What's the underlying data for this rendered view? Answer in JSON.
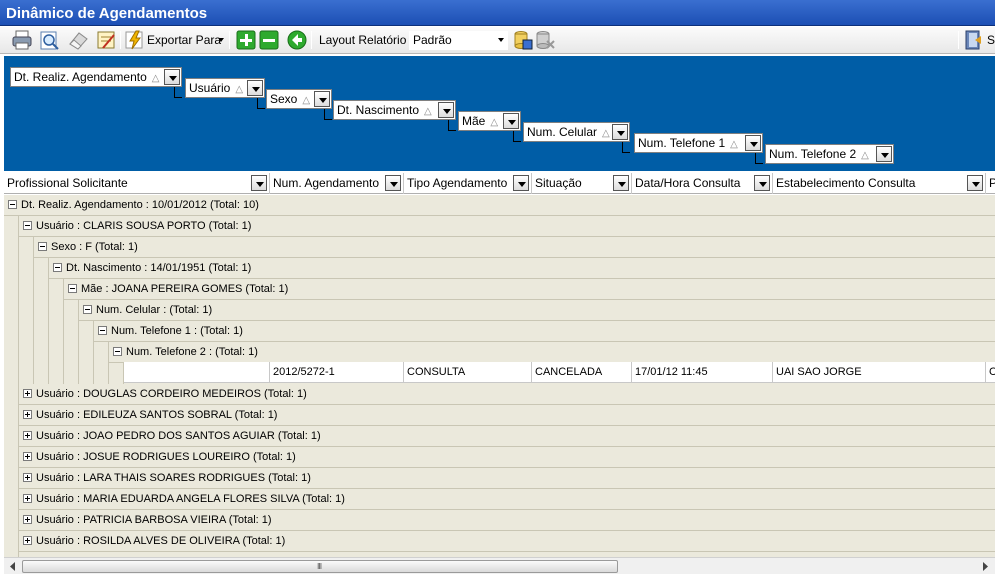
{
  "window": {
    "title": "Dinâmico de Agendamentos"
  },
  "toolbar": {
    "export_label": "Exportar Para",
    "layout_label": "Layout Relatório",
    "layout_value": "Padrão",
    "right_label": "S",
    "icons": [
      "printer-icon",
      "preview-icon",
      "eraser-icon",
      "edit-form-icon",
      "lightning-icon",
      "add-icon",
      "remove-icon",
      "back-icon",
      "save-db-icon",
      "delete-db-icon",
      "exit-icon"
    ]
  },
  "group_panel": {
    "groups": [
      "Dt. Realiz. Agendamento",
      "Usuário",
      "Sexo",
      "Dt. Nascimento",
      "Mãe",
      "Num. Celular",
      "Num. Telefone 1",
      "Num. Telefone 2"
    ],
    "sort_glyph": "△"
  },
  "columns": [
    "Profissional Solicitante",
    "Num. Agendamento",
    "Tipo Agendamento",
    "Situação",
    "Data/Hora Consulta",
    "Estabelecimento Consulta",
    "P"
  ],
  "tree": [
    {
      "label": "Dt. Realiz. Agendamento : 10/01/2012 (Total: 10)"
    },
    {
      "label": "Usuário : CLARIS SOUSA PORTO (Total: 1)"
    },
    {
      "label": "Sexo : F (Total: 1)"
    },
    {
      "label": "Dt. Nascimento : 14/01/1951 (Total: 1)"
    },
    {
      "label": "Mãe : JOANA PEREIRA GOMES (Total: 1)"
    },
    {
      "label": "Num. Celular :  (Total: 1)"
    },
    {
      "label": "Num. Telefone 1 :  (Total: 1)"
    },
    {
      "label": "Num. Telefone 2 :  (Total: 1)"
    }
  ],
  "data_row": {
    "profissional": "",
    "num_agendamento": "2012/5272-1",
    "tipo": "CONSULTA",
    "situacao": "CANCELADA",
    "data_hora": "17/01/12 11:45",
    "estabelecimento": "UAI SAO JORGE",
    "extra": "C"
  },
  "collapsed_users": [
    "Usuário : DOUGLAS CORDEIRO MEDEIROS (Total: 1)",
    "Usuário : EDILEUZA SANTOS SOBRAL (Total: 1)",
    "Usuário : JOAO PEDRO DOS SANTOS AGUIAR (Total: 1)",
    "Usuário : JOSUE RODRIGUES LOUREIRO (Total: 1)",
    "Usuário : LARA THAIS SOARES RODRIGUES (Total: 1)",
    "Usuário : MARIA EDUARDA ANGELA FLORES SILVA (Total: 1)",
    "Usuário : PATRICIA BARBOSA VIEIRA (Total: 1)",
    "Usuário : ROSILDA ALVES DE OLIVEIRA (Total: 1)"
  ],
  "scrollbar": {
    "grip": "III"
  }
}
